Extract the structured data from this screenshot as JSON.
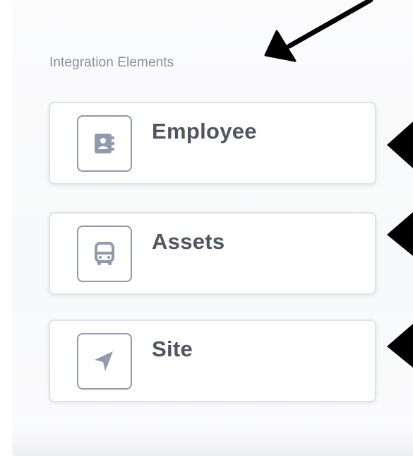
{
  "section": {
    "title": "Integration Elements"
  },
  "items": [
    {
      "label": "Employee",
      "icon": "address-book-icon"
    },
    {
      "label": "Assets",
      "icon": "bus-icon"
    },
    {
      "label": "Site",
      "icon": "navigation-arrow-icon"
    }
  ],
  "colors": {
    "icon": "#8f9aad",
    "label": "#4f5561",
    "section_title": "#8a8f97",
    "card_border": "#dde2ec",
    "annotation_arrow": "#000000"
  }
}
